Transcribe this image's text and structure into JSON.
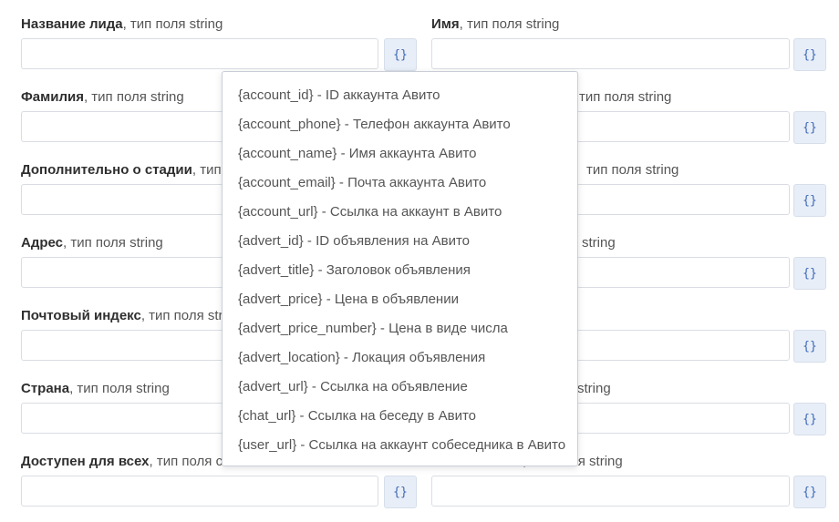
{
  "type_suffix": ", тип поля string",
  "fields_left": [
    {
      "name": "Название лида",
      "type": ", тип поля string",
      "button": "{}"
    },
    {
      "name": "Фамилия",
      "type": ", тип поля string",
      "button": "{}"
    },
    {
      "name": "Дополнительно о стадии",
      "type": ", тип поля string",
      "button": "{}"
    },
    {
      "name": "Адрес",
      "type": ", тип поля string",
      "button": "{}"
    },
    {
      "name": "Почтовый индекс",
      "type": ", тип поля string",
      "button": "{}"
    },
    {
      "name": "Страна",
      "type": ", тип поля string",
      "button": "{}"
    },
    {
      "name": "Доступен для всех",
      "type": ", тип поля char",
      "button": "{}"
    }
  ],
  "fields_right": [
    {
      "name": "Имя",
      "type": ", тип поля string",
      "button": "{}"
    },
    {
      "name": "",
      "type": "тип поля string",
      "button": "{}"
    },
    {
      "name": "",
      "type": "тип поля string",
      "button": "{}"
    },
    {
      "name": "",
      "type": "string",
      "button": "{}"
    },
    {
      "name": "",
      "type": "",
      "button": "{}"
    },
    {
      "name": "",
      "type": "string",
      "button": "{}"
    },
    {
      "name": "",
      "type": ", тип поля string",
      "button": "{}"
    }
  ],
  "dropdown": {
    "items": [
      {
        "key": "{account_id}",
        "desc": " - ID аккаунта Авито"
      },
      {
        "key": "{account_phone}",
        "desc": " - Телефон аккаунта Авито"
      },
      {
        "key": "{account_name}",
        "desc": " - Имя аккаунта Авито"
      },
      {
        "key": "{account_email}",
        "desc": " - Почта аккаунта Авито"
      },
      {
        "key": "{account_url}",
        "desc": " - Ссылка на аккаунт в Авито"
      },
      {
        "key": "{advert_id}",
        "desc": " - ID объявления на Авито"
      },
      {
        "key": "{advert_title}",
        "desc": " - Заголовок объявления"
      },
      {
        "key": "{advert_price}",
        "desc": " - Цена в объявлении"
      },
      {
        "key": "{advert_price_number}",
        "desc": " - Цена в виде числа"
      },
      {
        "key": "{advert_location}",
        "desc": " - Локация объявления"
      },
      {
        "key": "{advert_url}",
        "desc": " - Ссылка на объявление"
      },
      {
        "key": "{chat_url}",
        "desc": " - Ссылка на беседу в Авито"
      },
      {
        "key": "{user_url}",
        "desc": " - Ссылка на аккаунт собеседника в Авито"
      }
    ]
  }
}
